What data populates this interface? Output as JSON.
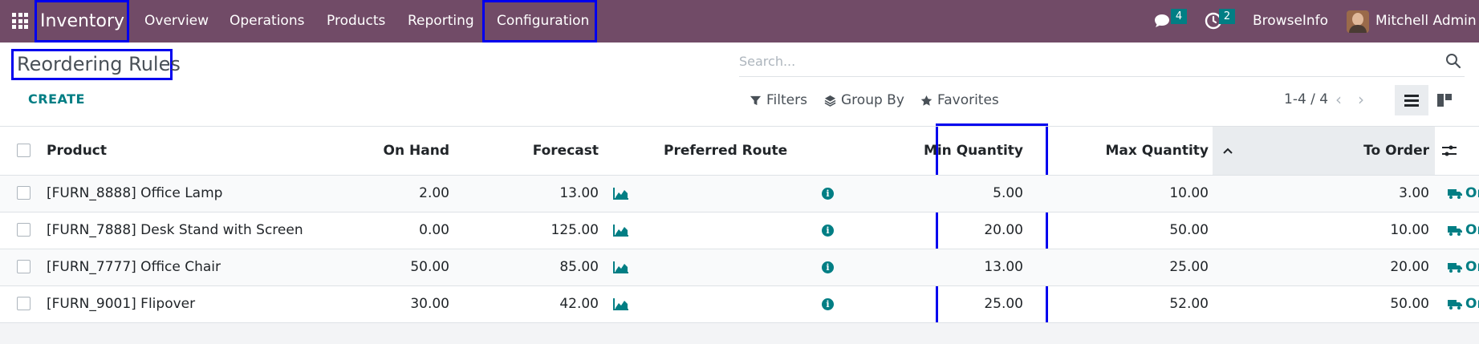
{
  "topnav": {
    "app_name": "Inventory",
    "menu": [
      "Overview",
      "Operations",
      "Products",
      "Reporting",
      "Configuration"
    ],
    "messages_count": "4",
    "activities_count": "2",
    "company": "BrowseInfo",
    "user": "Mitchell Admin"
  },
  "control": {
    "title": "Reordering Rules",
    "create_label": "CREATE",
    "search_placeholder": "Search...",
    "filters_label": "Filters",
    "groupby_label": "Group By",
    "favorites_label": "Favorites",
    "pager": "1-4 / 4"
  },
  "table": {
    "headers": {
      "product": "Product",
      "on_hand": "On Hand",
      "forecast": "Forecast",
      "route": "Preferred Route",
      "min_qty": "Min Quantity",
      "max_qty": "Max Quantity",
      "to_order": "To Order"
    },
    "rows": [
      {
        "product": "[FURN_8888] Office Lamp",
        "on_hand": "2.00",
        "forecast": "13.00",
        "min_qty": "5.00",
        "max_qty": "10.00",
        "to_order": "3.00",
        "order": "Or"
      },
      {
        "product": "[FURN_7888] Desk Stand with Screen",
        "on_hand": "0.00",
        "forecast": "125.00",
        "min_qty": "20.00",
        "max_qty": "50.00",
        "to_order": "10.00",
        "order": "Or"
      },
      {
        "product": "[FURN_7777] Office Chair",
        "on_hand": "50.00",
        "forecast": "85.00",
        "min_qty": "13.00",
        "max_qty": "25.00",
        "to_order": "20.00",
        "order": "Or"
      },
      {
        "product": "[FURN_9001] Flipover",
        "on_hand": "30.00",
        "forecast": "42.00",
        "min_qty": "25.00",
        "max_qty": "52.00",
        "to_order": "50.00",
        "order": "Or"
      }
    ]
  },
  "colors": {
    "navbar": "#714b67",
    "accent": "#017e84",
    "highlight_box": "#0000ee"
  }
}
